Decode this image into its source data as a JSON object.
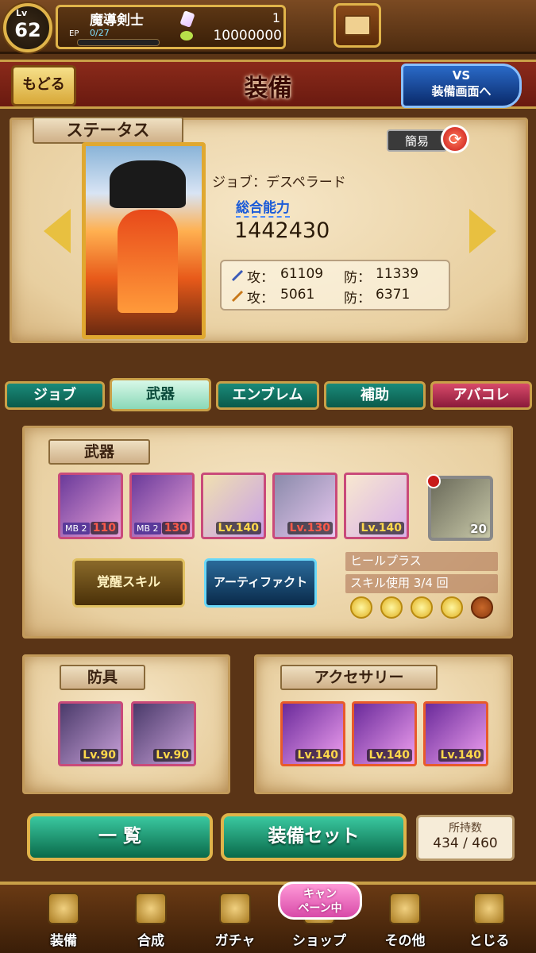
{
  "player": {
    "level_label": "Lv",
    "level": "62",
    "name": "魔導剣士",
    "ep_label": "EP",
    "ep": "0/27",
    "crystals": "1",
    "gold": "10000000"
  },
  "header": {
    "back_label": "もどる",
    "title": "装備",
    "vs_line1": "VS",
    "vs_line2": "装備画面へ"
  },
  "status": {
    "ribbon": "ステータス",
    "simple_label": "簡易",
    "job": "ジョブ：デスペラード",
    "power_label": "総合能力",
    "power_value": "1442430",
    "physical": {
      "atk_label": "攻：",
      "atk": "61109",
      "def_label": "防：",
      "def": "11339"
    },
    "magic": {
      "atk_label": "攻：",
      "atk": "5061",
      "def_label": "防：",
      "def": "6371"
    }
  },
  "tabs": [
    "ジョブ",
    "武器",
    "エンブレム",
    "補助",
    "アバコレ"
  ],
  "weapons": {
    "ribbon": "武器",
    "cards": [
      {
        "mb": "MB 2",
        "lv": "110"
      },
      {
        "mb": "MB 2",
        "lv": "130"
      },
      {
        "mb": "",
        "lv": "Lv.140"
      },
      {
        "mb": "",
        "lv": "Lv.130"
      },
      {
        "mb": "",
        "lv": "Lv.140"
      }
    ],
    "equipped_count": "20",
    "awaken_label": "覚醒スキル",
    "artifact_label": "アーティファクト",
    "skill_name": "ヒールプラス",
    "skill_usage": "スキル使用 3/4 回",
    "coins_filled": 4,
    "coins_total": 5
  },
  "armor": {
    "ribbon": "防具",
    "cards": [
      {
        "lv": "Lv.90"
      },
      {
        "lv": "Lv.90"
      }
    ]
  },
  "accessory": {
    "ribbon": "アクセサリー",
    "cards": [
      {
        "lv": "Lv.140"
      },
      {
        "lv": "Lv.140"
      },
      {
        "lv": "Lv.140"
      }
    ]
  },
  "actions": {
    "list_label": "一 覧",
    "equip_set_label": "装備セット",
    "owned_label": "所持数",
    "owned_count": "434 / 460"
  },
  "nav": {
    "items": [
      "装備",
      "合成",
      "ガチャ",
      "ショップ",
      "その他",
      "とじる"
    ],
    "campaign_badge_line1": "キャン",
    "campaign_badge_line2": "ペーン中"
  }
}
